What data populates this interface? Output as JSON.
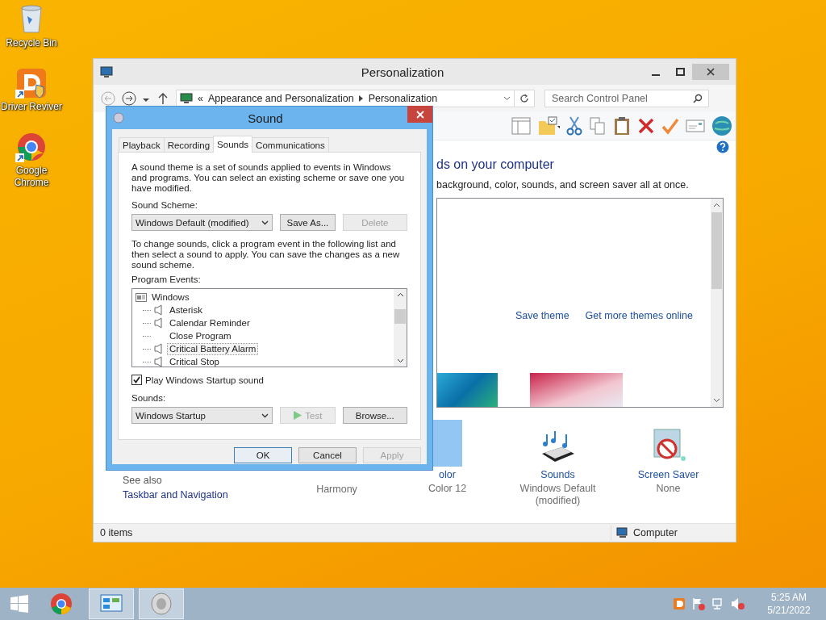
{
  "desktop_icons": [
    {
      "label": "Recycle Bin",
      "kind": "bin"
    },
    {
      "label": "Driver Reviver",
      "kind": "reviver",
      "shortcut": true
    },
    {
      "label": "Google Chrome",
      "kind": "chrome",
      "shortcut": true
    }
  ],
  "personalization": {
    "title": "Personalization",
    "breadcrumb_prefix": "«",
    "path": [
      "Appearance and Personalization",
      "Personalization"
    ],
    "search": {
      "placeholder": "Search Control Panel"
    },
    "heading": "ds on your computer",
    "description": "background, color, sounds, and screen saver all at once.",
    "theme_links": [
      "Save theme",
      "Get more themes online"
    ],
    "items": [
      {
        "kind": "desktop",
        "value": "Harmony"
      },
      {
        "kind": "color",
        "link": "olor",
        "value": "Color 12"
      },
      {
        "kind": "sounds",
        "link": "Sounds",
        "value": "Windows Default (modified)"
      },
      {
        "kind": "screensaver",
        "link": "Screen Saver",
        "value": "None"
      }
    ],
    "see_also": {
      "title": "See also",
      "links": [
        "Taskbar and Navigation"
      ]
    },
    "status_bar": {
      "count": "0 items",
      "location": "Computer"
    }
  },
  "sound_dialog": {
    "title": "Sound",
    "tabs": [
      {
        "label": "Playback",
        "selected": false
      },
      {
        "label": "Recording",
        "selected": false
      },
      {
        "label": "Sounds",
        "selected": true
      },
      {
        "label": "Communications",
        "selected": false
      }
    ],
    "intro": "A sound theme is a set of sounds applied to events in Windows and programs.  You can select an existing scheme or save one you have modified.",
    "scheme_label": "Sound Scheme:",
    "scheme_value": "Windows Default (modified)",
    "scheme_buttons": [
      {
        "label": "Save As...",
        "disabled": false
      },
      {
        "label": "Delete",
        "disabled": true
      }
    ],
    "instructions": "To change sounds, click a program event in the following list and then select a sound to apply.  You can save the changes as a new sound scheme.",
    "events_label": "Program Events:",
    "events": {
      "label": "Windows",
      "children": [
        {
          "label": "Asterisk",
          "has_sound": true,
          "selected": false
        },
        {
          "label": "Calendar Reminder",
          "has_sound": true,
          "selected": false
        },
        {
          "label": "Close Program",
          "has_sound": false,
          "selected": false
        },
        {
          "label": "Critical Battery Alarm",
          "has_sound": true,
          "selected": true
        },
        {
          "label": "Critical Stop",
          "has_sound": true,
          "selected": false
        }
      ]
    },
    "startup_checkbox": {
      "label": "Play Windows Startup sound",
      "checked": true
    },
    "sounds_label": "Sounds:",
    "sound_value": "Windows Startup",
    "sound_buttons": [
      {
        "label": "Test",
        "kind": "test",
        "disabled": true
      },
      {
        "label": "Browse...",
        "kind": "plain",
        "disabled": false
      }
    ],
    "footer_buttons": [
      {
        "label": "OK",
        "default": true,
        "disabled": false
      },
      {
        "label": "Cancel",
        "default": false,
        "disabled": false
      },
      {
        "label": "Apply",
        "default": false,
        "disabled": true
      }
    ]
  },
  "taskbar": {
    "apps": [
      {
        "kind": "chrome",
        "open": false
      },
      {
        "kind": "control-panel",
        "open": true
      },
      {
        "kind": "sound",
        "open": true
      }
    ],
    "time": "5:25 AM",
    "date": "5/21/2022"
  }
}
